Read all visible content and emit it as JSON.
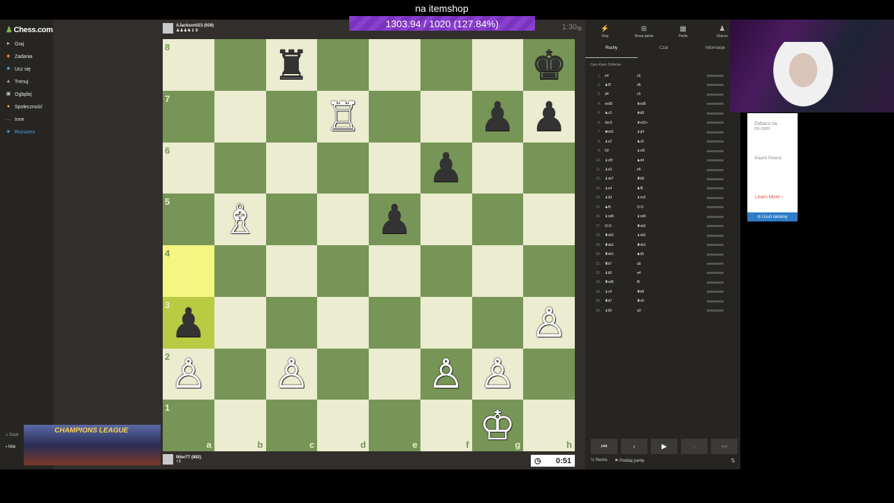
{
  "banner": {
    "title": "na itemshop",
    "progress": "1303.94 / 1020 (127.84%)"
  },
  "sidebar": {
    "logo": "Chess.com",
    "items": [
      {
        "label": "Graj",
        "icon": "play-icon",
        "color": "#e8e8e8"
      },
      {
        "label": "Zadania",
        "icon": "puzzle-icon",
        "color": "#e8e8e8"
      },
      {
        "label": "Ucz się",
        "icon": "learn-icon",
        "color": "#e8e8e8"
      },
      {
        "label": "Trenuj",
        "icon": "train-icon",
        "color": "#e8e8e8"
      },
      {
        "label": "Oglądaj",
        "icon": "watch-icon",
        "color": "#e8e8e8"
      },
      {
        "label": "Społeczność",
        "icon": "community-icon",
        "color": "#e8e8e8"
      },
      {
        "label": "Inne",
        "icon": "more-icon",
        "color": "#e8e8e8"
      },
      {
        "label": "Rozszerz",
        "icon": "expand-icon",
        "color": "#4fa7e6"
      }
    ],
    "search": "Szuk",
    "user": "Nite"
  },
  "players": {
    "top": {
      "name": "AJackson023 (928)",
      "captured": "♟♟♟♞♝♛",
      "clock": "1:30"
    },
    "bottom": {
      "name": "Niter77 (882)",
      "captured": "+3",
      "clock": "0:51"
    }
  },
  "board": {
    "ranks": [
      "8",
      "7",
      "6",
      "5",
      "4",
      "3",
      "2",
      "1"
    ],
    "files": [
      "a",
      "b",
      "c",
      "d",
      "e",
      "f",
      "g",
      "h"
    ],
    "highlight": [
      "a4",
      "a3"
    ],
    "pieces": {
      "c8": "♜b",
      "h8": "♚b",
      "d7": "♖w",
      "g7": "♟b",
      "h7": "♟b",
      "f6": "♟b",
      "b5": "♗w",
      "e5": "♟b",
      "a3": "♟b",
      "h3": "♙w",
      "a2": "♙w",
      "c2": "♙w",
      "f2": "♙w",
      "g2": "♙w",
      "g1": "♔w"
    }
  },
  "panel": {
    "tabs": [
      "Graj",
      "Nowa partia",
      "Partie",
      "Gracze"
    ],
    "subtabs": [
      "Ruchy",
      "Czat",
      "Informacje"
    ],
    "opening": "Caro-Kann Defense",
    "moves": [
      [
        "1.",
        "e4",
        "c6"
      ],
      [
        "2.",
        "♞f3",
        "d5"
      ],
      [
        "3.",
        "d4",
        "c5"
      ],
      [
        "4.",
        "exd5",
        "♛xd5"
      ],
      [
        "5.",
        "♞c3",
        "♛d8"
      ],
      [
        "6.",
        "dxc5",
        "♛xd1+"
      ],
      [
        "7.",
        "♚xd1",
        "♝g4"
      ],
      [
        "8.",
        "♝e2",
        "♞c6"
      ],
      [
        "9.",
        "h3",
        "♝xf3"
      ],
      [
        "10.",
        "♝xf3",
        "♞d4"
      ],
      [
        "11.",
        "♝e3",
        "e5"
      ],
      [
        "12.",
        "♝xb7",
        "♜b8"
      ],
      [
        "13.",
        "♝e4",
        "♞f6"
      ],
      [
        "14.",
        "♝d3",
        "♝xc5"
      ],
      [
        "15.",
        "♞f5",
        "O-O"
      ],
      [
        "16.",
        "♝xd4",
        "♝xd4"
      ],
      [
        "17.",
        "O-O",
        "♜xb2"
      ],
      [
        "18.",
        "♜xb2",
        "♝xb2"
      ],
      [
        "19.",
        "♜ab1",
        "♜xb1"
      ],
      [
        "20.",
        "♜xb1",
        "♞d5"
      ],
      [
        "21.",
        "♜b7",
        "a5"
      ],
      [
        "22.",
        "♝b5",
        "a4"
      ],
      [
        "23.",
        "♜xd5",
        "f6"
      ],
      [
        "24.",
        "♝c4",
        "♜b8"
      ],
      [
        "25.",
        "♜d7",
        "♜c8"
      ],
      [
        "26.",
        "♝b5",
        "a3"
      ]
    ],
    "actions": {
      "draw": "Remis",
      "resign": "Poddaj partię"
    }
  },
  "ad": {
    "title": "Zobacz na mi.com",
    "brand": "Xiaomi Poland",
    "more": "Learn More",
    "remove": "Usuń reklamy"
  },
  "overlay": {
    "text": "CHAMPIONS LEAGUE"
  }
}
